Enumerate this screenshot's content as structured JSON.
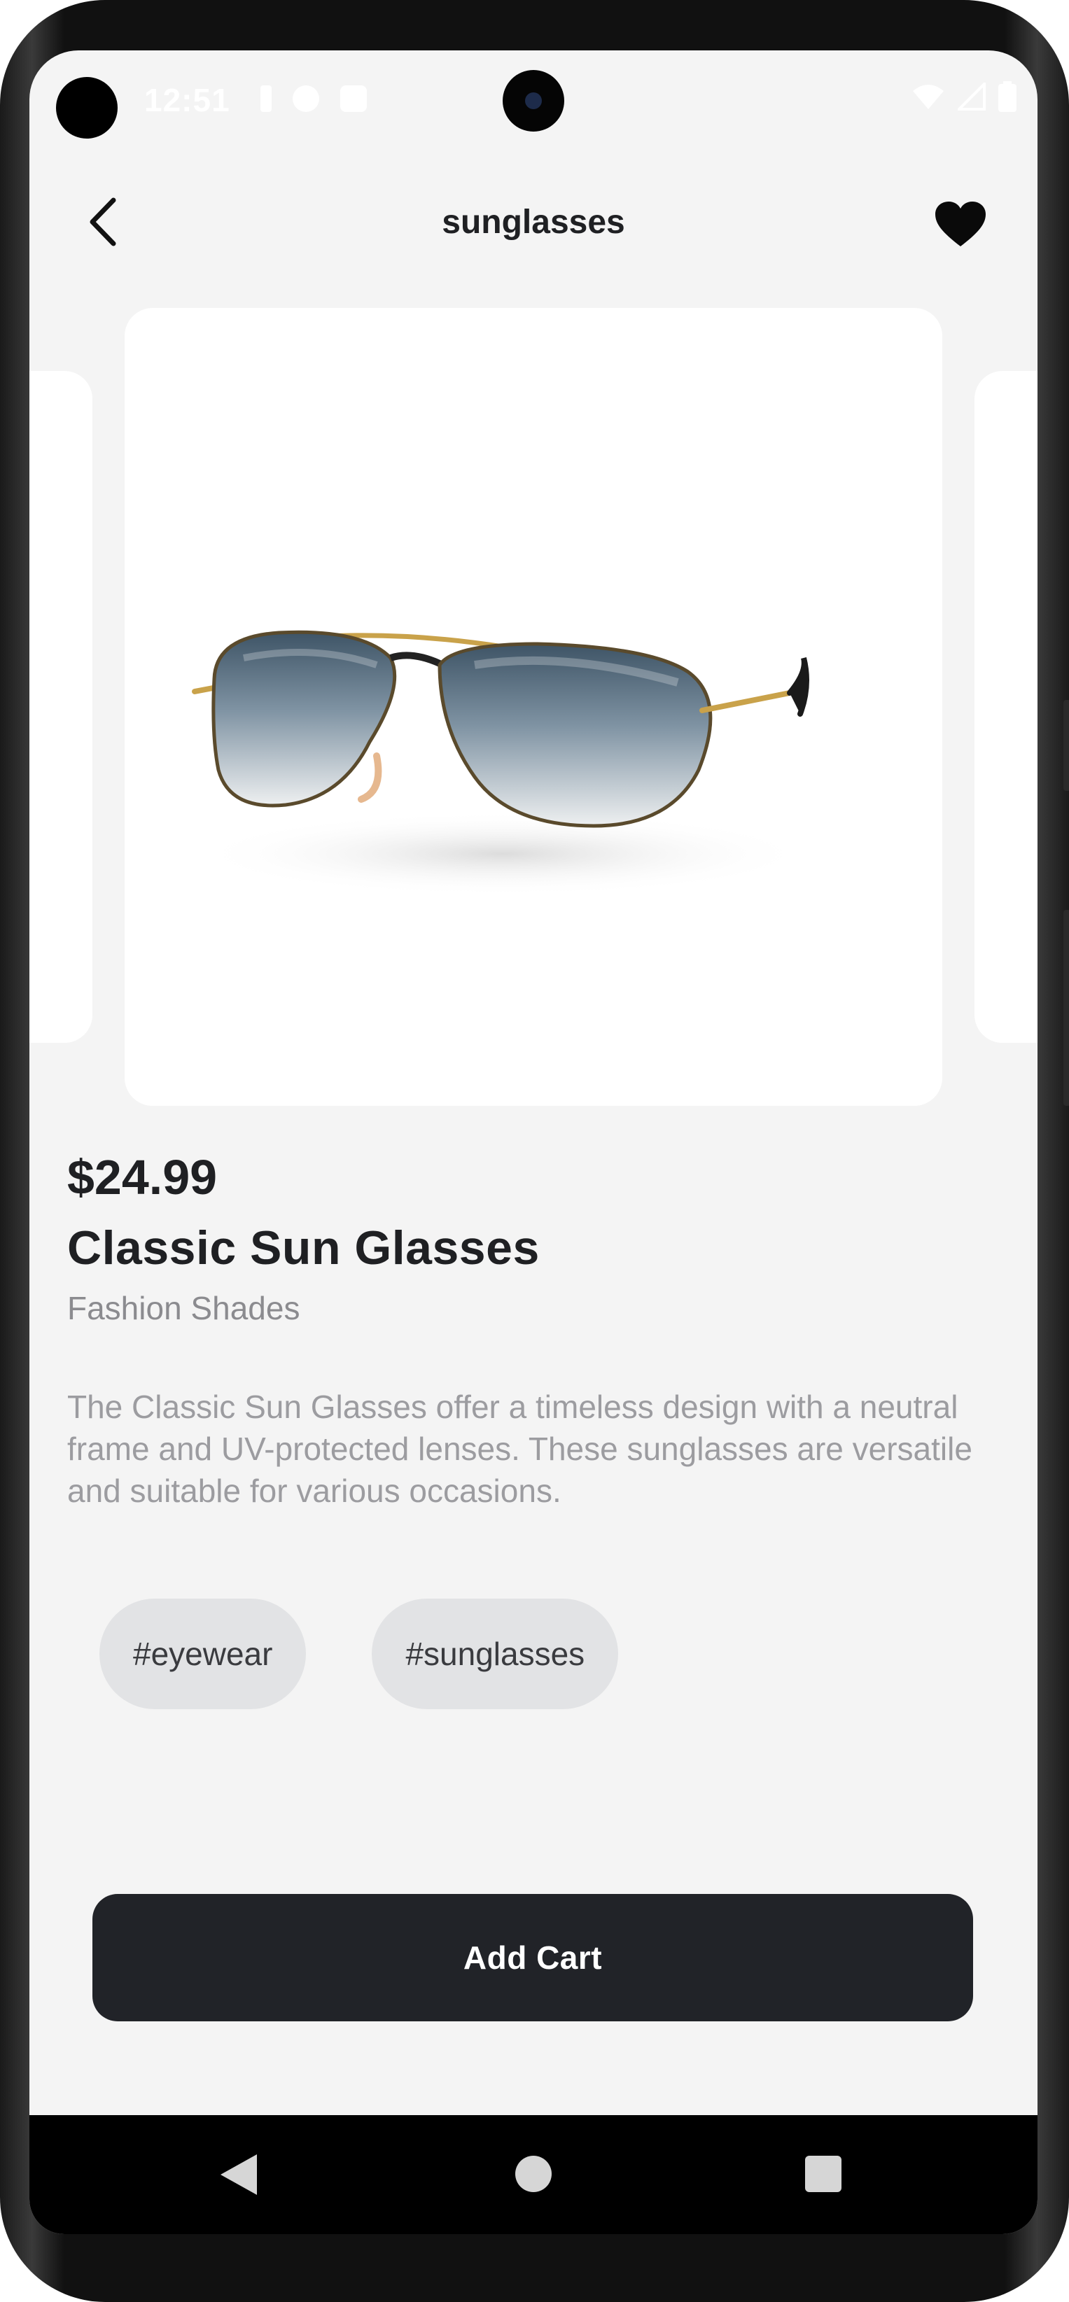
{
  "status_bar": {
    "time": "12:51"
  },
  "app_bar": {
    "title": "sunglasses",
    "back_icon": "chevron-left-icon",
    "favorite_icon": "heart-icon",
    "favorite_active": true
  },
  "product": {
    "image": "aviator-sunglasses",
    "price": "$24.99",
    "name": "Classic Sun Glasses",
    "brand": "Fashion Shades",
    "description": "The Classic Sun Glasses offer a timeless design with a neutral frame and UV-protected lenses. These sunglasses are versatile and suitable for various occasions.",
    "tags": [
      "#eyewear",
      "#sunglasses"
    ]
  },
  "actions": {
    "add_cart_label": "Add Cart"
  },
  "colors": {
    "background": "#f4f4f4",
    "card": "#ffffff",
    "text_primary": "#1f2023",
    "text_secondary": "#8b8b8f",
    "tag_background": "#e2e3e5",
    "button_background": "#212328",
    "button_text": "#ffffff"
  }
}
